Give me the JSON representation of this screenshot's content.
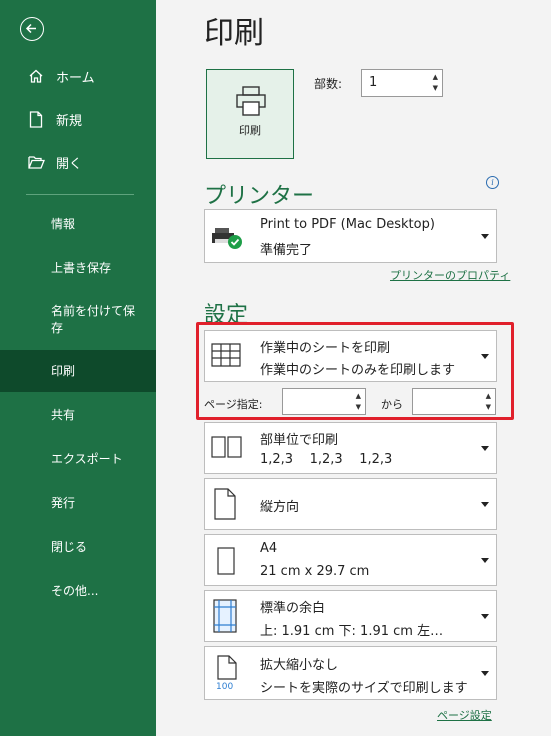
{
  "sidebar": {
    "back_icon": "back-arrow-icon",
    "top_items": [
      {
        "label": "ホーム",
        "icon": "home-icon"
      },
      {
        "label": "新規",
        "icon": "new-document-icon"
      },
      {
        "label": "開く",
        "icon": "open-folder-icon"
      }
    ],
    "items": [
      {
        "label": "情報"
      },
      {
        "label": "上書き保存"
      },
      {
        "label": "名前を付けて保存"
      },
      {
        "label": "印刷",
        "active": true
      },
      {
        "label": "共有"
      },
      {
        "label": "エクスポート"
      },
      {
        "label": "発行"
      },
      {
        "label": "閉じる"
      },
      {
        "label": "その他..."
      }
    ],
    "background_color": "#1e7145",
    "active_color": "#0e4a2b"
  },
  "main": {
    "title": "印刷",
    "print_button_label": "印刷",
    "copies_label": "部数:",
    "copies_value": "1",
    "printer": {
      "heading": "プリンター",
      "name": "Print to PDF (Mac Desktop)",
      "status": "準備完了",
      "properties_link": "プリンターのプロパティ"
    },
    "settings": {
      "heading": "設定",
      "scope": {
        "title": "作業中のシートを印刷",
        "desc": "作業中のシートのみを印刷します"
      },
      "pages_label": "ページ指定:",
      "pages_to_label": "から",
      "collate": {
        "title": "部単位で印刷",
        "desc": "1,2,3    1,2,3    1,2,3"
      },
      "orientation": {
        "title": "縦方向"
      },
      "paper": {
        "title": "A4",
        "desc": "21 cm x 29.7 cm"
      },
      "margins": {
        "title": "標準の余白",
        "desc": "上: 1.91 cm 下: 1.91 cm 左…"
      },
      "scaling": {
        "title": "拡大縮小なし",
        "desc": "シートを実際のサイズで印刷します",
        "icon_text": "100"
      },
      "page_setup_link": "ページ設定"
    }
  },
  "highlight_color": "#e0202b"
}
